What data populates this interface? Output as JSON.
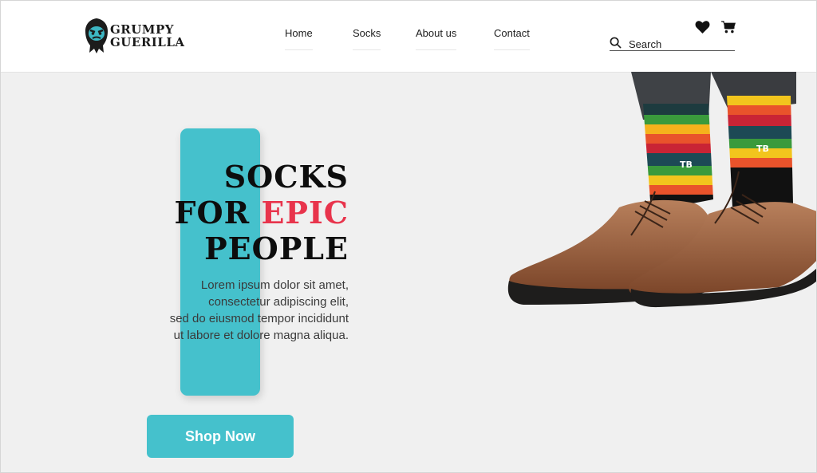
{
  "brand": {
    "line1": "GRUMPY",
    "line2": "GUERILLA"
  },
  "nav": {
    "items": [
      "Home",
      "Socks",
      "About us",
      "Contact"
    ]
  },
  "header_icons": [
    "heart-icon",
    "cart-icon"
  ],
  "search": {
    "label": "Search",
    "icon": "search-icon"
  },
  "hero": {
    "headline_line1": "SOCKS",
    "headline_line2_prefix": "FOR ",
    "headline_line2_accent": "EPIC",
    "headline_line3": "PEOPLE",
    "body_lines": [
      "Lorem ipsum dolor sit amet,",
      "consectetur adipiscing elit,",
      "sed do eiusmod tempor incididunt",
      "ut labore et dolore magna aliqua."
    ],
    "cta_label": "Shop Now"
  },
  "colors": {
    "accent": "#45c1cc",
    "highlight": "#e8344c",
    "background": "#f0f0f0",
    "text": "#0d0d0d"
  }
}
